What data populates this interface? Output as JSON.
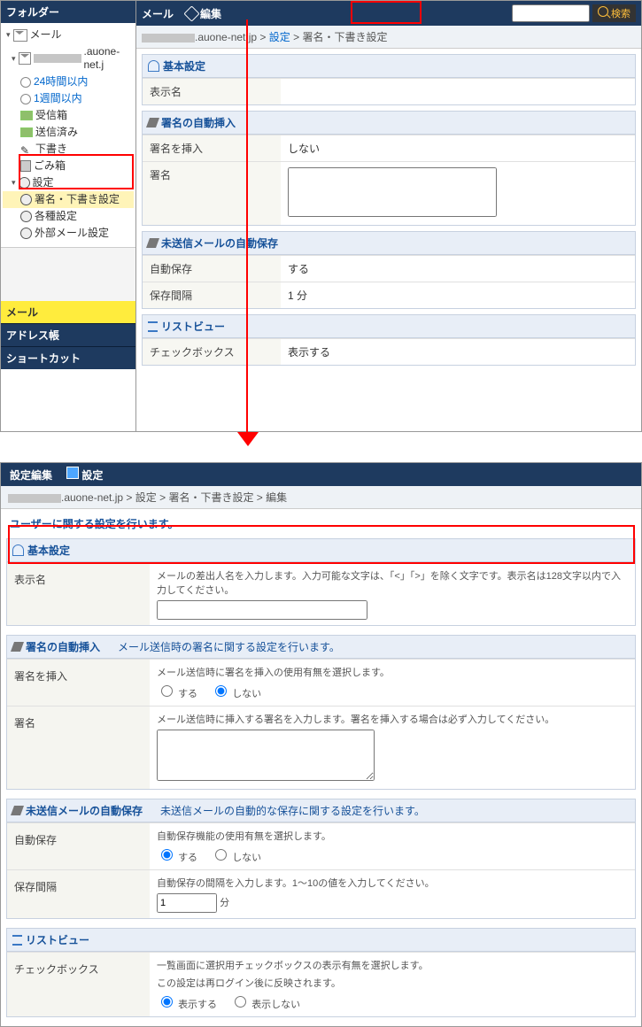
{
  "top": {
    "sidebar": {
      "title": "フォルダー",
      "root": "メール",
      "domain": ".auone-net.j",
      "items": {
        "in24h": "24時間以内",
        "in1w": "1週間以内",
        "inbox": "受信箱",
        "sent": "送信済み",
        "draft": "下書き",
        "trash": "ごみ箱",
        "settings": "設定",
        "sig_draft": "署名・下書き設定",
        "misc": "各種設定",
        "external": "外部メール設定"
      },
      "acc": {
        "mail": "メール",
        "addr": "アドレス帳",
        "short": "ショートカット"
      }
    },
    "main": {
      "title": "メール",
      "edit": "編集",
      "search": "検索",
      "crumb_domain": ".auone-net.jp",
      "crumb_set": "設定",
      "crumb_sig": "署名・下書き設定",
      "sect_basic": "基本設定",
      "row_display": "表示名",
      "sect_sig": "署名の自動挿入",
      "row_insert": "署名を挿入",
      "val_insert": "しない",
      "row_sig": "署名",
      "sect_autosave": "未送信メールの自動保存",
      "row_autosave": "自動保存",
      "val_autosave": "する",
      "row_interval": "保存間隔",
      "val_interval": "1 分",
      "sect_list": "リストビュー",
      "row_check": "チェックボックス",
      "val_check": "表示する"
    }
  },
  "bottom": {
    "title": "設定編集",
    "save": "設定",
    "crumb_domain": ".auone-net.jp",
    "crumb_set": "設定",
    "crumb_sig": "署名・下書き設定",
    "crumb_edit": "編集",
    "lead": "ユーザーに関する設定を行います。",
    "basic": {
      "title": "基本設定",
      "display_lbl": "表示名",
      "display_hint": "メールの差出人名を入力します。入力可能な文字は、「<」「>」を除く文字です。表示名は128文字以内で入力してください。"
    },
    "sig": {
      "title": "署名の自動挿入",
      "lead": "メール送信時の署名に関する設定を行います。",
      "insert_lbl": "署名を挿入",
      "insert_hint": "メール送信時に署名を挿入の使用有無を選択します。",
      "insert_yes": "する",
      "insert_no": "しない",
      "sig_lbl": "署名",
      "sig_hint": "メール送信時に挿入する署名を入力します。署名を挿入する場合は必ず入力してください。"
    },
    "autosave": {
      "title": "未送信メールの自動保存",
      "lead": "未送信メールの自動的な保存に関する設定を行います。",
      "auto_lbl": "自動保存",
      "auto_hint": "自動保存機能の使用有無を選択します。",
      "auto_yes": "する",
      "auto_no": "しない",
      "int_lbl": "保存間隔",
      "int_hint": "自動保存の間隔を入力します。1～10の値を入力してください。",
      "int_val": "1",
      "int_unit": "分"
    },
    "list": {
      "title": "リストビュー",
      "chk_lbl": "チェックボックス",
      "chk_hint1": "一覧画面に選択用チェックボックスの表示有無を選択します。",
      "chk_hint2": "この設定は再ログイン後に反映されます。",
      "chk_yes": "表示する",
      "chk_no": "表示しない"
    }
  }
}
